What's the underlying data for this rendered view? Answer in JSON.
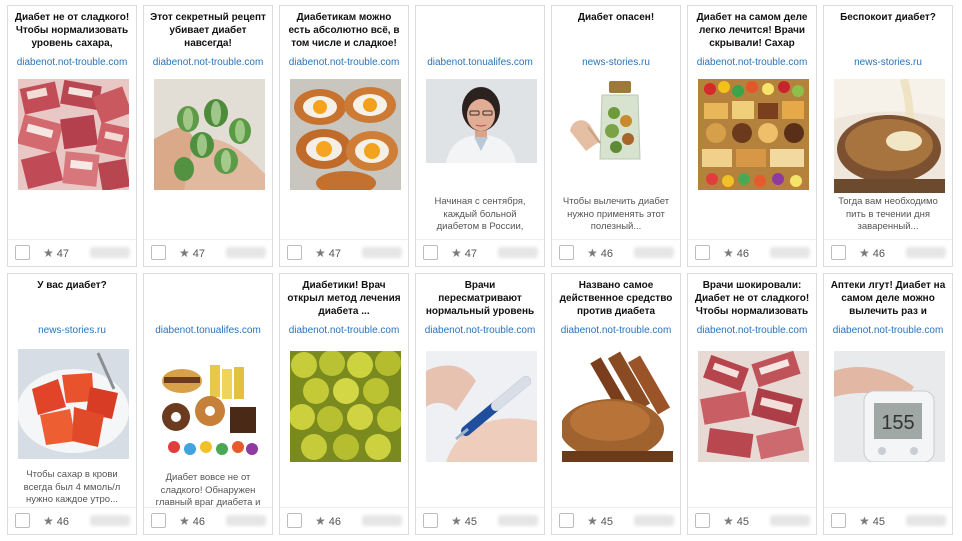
{
  "cards": [
    {
      "title": "Диабет не от сладкого! Чтобы нормализовать уровень сахара,",
      "domain": "diabenot.not-trouble.com",
      "description": "",
      "rating": "47",
      "image": "bacon-image"
    },
    {
      "title": "Этот секретный рецепт убивает диабет навсегда!",
      "domain": "diabenot.not-trouble.com",
      "description": "",
      "rating": "47",
      "image": "cucamelon-image"
    },
    {
      "title": "Диабетикам можно есть абсолютно всё, в том числе и сладкое!",
      "domain": "diabenot.not-trouble.com",
      "description": "",
      "rating": "47",
      "image": "egg-boats-image"
    },
    {
      "title": "",
      "domain": "diabenot.tonualifes.com",
      "description": "Начиная с сентября, каждый больной диабетом в России, имеет право на",
      "rating": "47",
      "image": "doctor-image"
    },
    {
      "title": "Диабет опасен!",
      "domain": "news-stories.ru",
      "description": "Чтобы вылечить диабет нужно применять этот полезный...",
      "rating": "46",
      "image": "herbal-jar-image"
    },
    {
      "title": "Диабет на самом деле легко лечится! Врачи скрывали! Сахар",
      "domain": "diabenot.not-trouble.com",
      "description": "",
      "rating": "46",
      "image": "sweets-image"
    },
    {
      "title": "Беспокоит диабет?",
      "domain": "news-stories.ru",
      "description": "Тогда вам необходимо пить в течении дня заваренный...",
      "rating": "46",
      "image": "powder-cup-image"
    },
    {
      "title": "У вас диабет?",
      "domain": "news-stories.ru",
      "description": "Чтобы сахар в крови всегда был 4 ммоль/л нужно каждое утро...",
      "rating": "46",
      "image": "jelly-image"
    },
    {
      "title": "",
      "domain": "diabenot.tonualifes.com",
      "description": "Диабет вовсе не от сладкого! Обнаружен главный враг диабета и это...",
      "rating": "46",
      "image": "junk-food-image"
    },
    {
      "title": "Диабетики! Врач открыл метод лечения диабета ...",
      "domain": "diabenot.not-trouble.com",
      "description": "",
      "rating": "46",
      "image": "gooseberry-image"
    },
    {
      "title": "Врачи пересматривают нормальный уровень",
      "domain": "diabenot.not-trouble.com",
      "description": "",
      "rating": "45",
      "image": "insulin-pen-image"
    },
    {
      "title": "Названо самое действенное средство против диабета",
      "domain": "diabenot.not-trouble.com",
      "description": "",
      "rating": "45",
      "image": "cinnamon-image"
    },
    {
      "title": "Врачи шокировали: Диабет не от сладкого! Чтобы нормализовать",
      "domain": "diabenot.not-trouble.com",
      "description": "",
      "rating": "45",
      "image": "bacon-plate-image"
    },
    {
      "title": "Аптеки лгут! Диабет на самом деле можно вылечить раз и",
      "domain": "diabenot.not-trouble.com",
      "description": "",
      "rating": "45",
      "image": "glucometer-image"
    }
  ]
}
